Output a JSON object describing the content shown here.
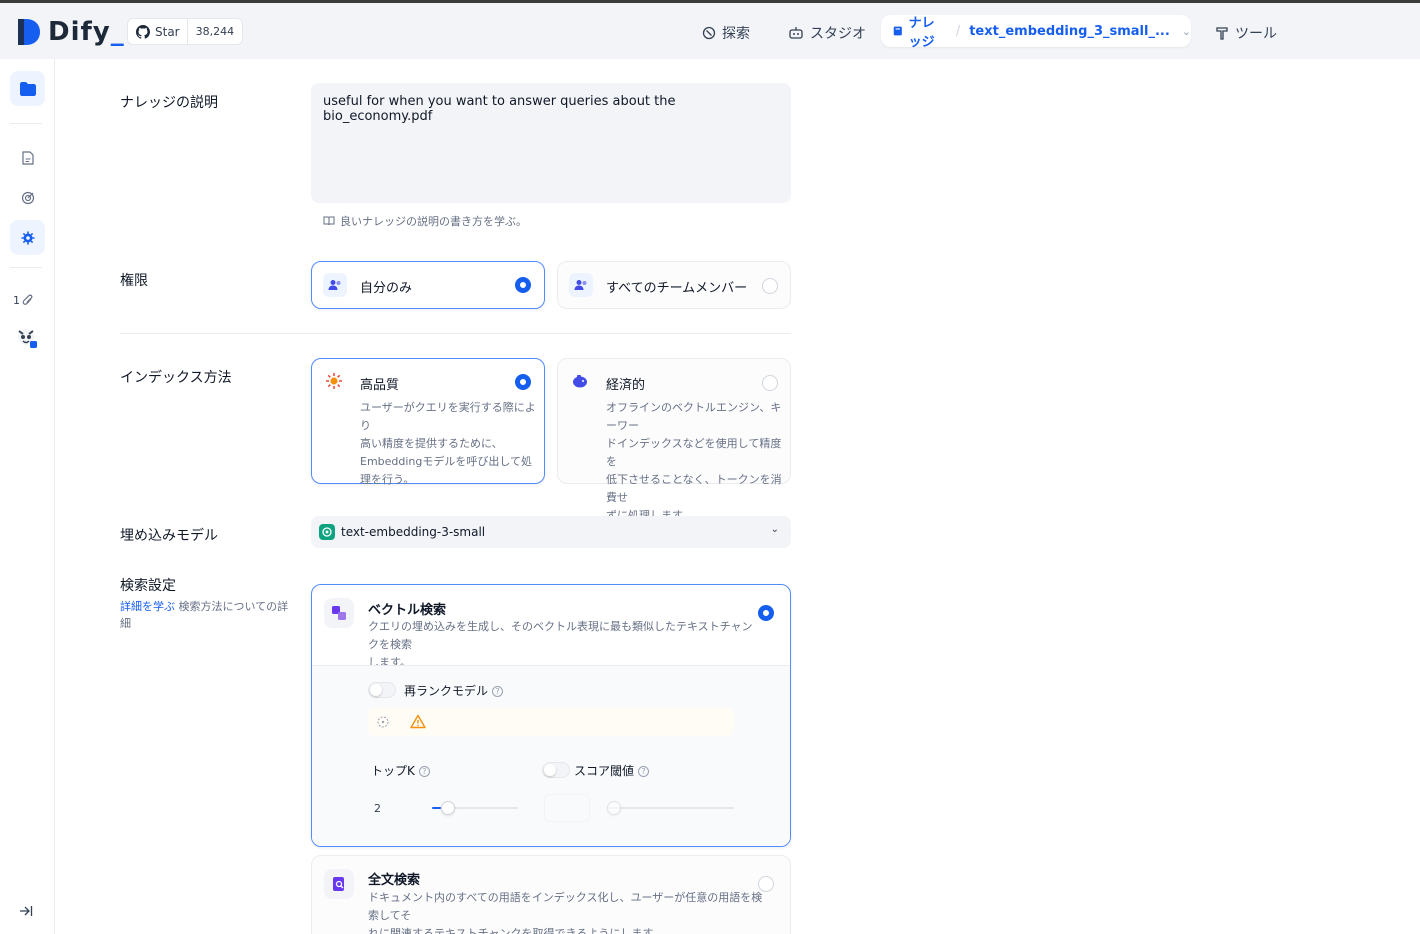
{
  "header": {
    "logo_text": "Dify",
    "github": {
      "star_label": "Star",
      "star_count": "38,244"
    },
    "nav": {
      "explore": "探索",
      "studio": "スタジオ",
      "knowledge": "ナレッジ",
      "current_knowledge": "text_embedding_3_small_...",
      "tools": "ツール"
    }
  },
  "sidebar": {
    "doc_count": "1"
  },
  "form": {
    "description": {
      "label": "ナレッジの説明",
      "value": "useful for when you want to answer queries about the bio_economy.pdf",
      "hint": "良いナレッジの説明の書き方を学ぶ。"
    },
    "permission": {
      "label": "権限",
      "options": [
        {
          "label": "自分のみ",
          "selected": true
        },
        {
          "label": "すべてのチームメンバー",
          "selected": false
        }
      ]
    },
    "indexing": {
      "label": "インデックス方法",
      "options": [
        {
          "title": "高品質",
          "desc": [
            "ユーザーがクエリを実行する際により",
            "高い精度を提供するために、",
            "Embeddingモデルを呼び出して処",
            "理を行う。"
          ],
          "selected": true
        },
        {
          "title": "経済的",
          "desc": [
            "オフラインのベクトルエンジン、キーワー",
            "ドインデックスなどを使用して精度を",
            "低下させることなく、トークンを消費せ",
            "ずに処理します。"
          ],
          "selected": false
        }
      ]
    },
    "embedding": {
      "label": "埋め込みモデル",
      "model": "text-embedding-3-small"
    },
    "retrieval": {
      "label": "検索設定",
      "learn_more": "詳細を学ぶ",
      "help_text_1": "検索方法についての詳",
      "help_text_2": "細",
      "vector": {
        "title": "ベクトル検索",
        "desc_1": "クエリの埋め込みを生成し、そのベクトル表現に最も類似したテキストチャンクを検索",
        "desc_2": "します。",
        "selected": true,
        "rerank_label": "再ランクモデル",
        "rerank_enabled": false,
        "topk_label": "トップK",
        "topk_value": "2",
        "topk_fraction": 0.1,
        "score_label": "スコア閾値",
        "score_enabled": false
      },
      "fulltext": {
        "title": "全文検索",
        "desc_1": "ドキュメント内のすべての用語をインデックス化し、ユーザーが任意の用語を検索してそ",
        "desc_2": "れに関連するテキストチャンクを取得できるようにします。",
        "selected": false
      }
    }
  },
  "colors": {
    "primary": "#155eef",
    "warning": "#f79009",
    "openai_green": "#10a37f"
  }
}
